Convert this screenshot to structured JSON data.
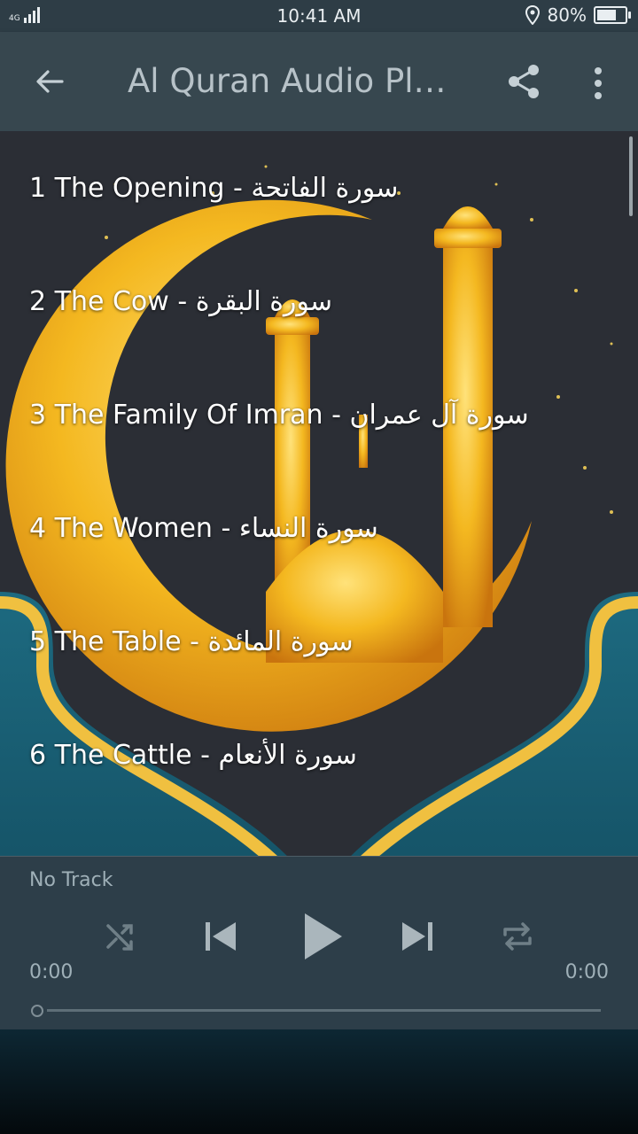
{
  "status_bar": {
    "network": "4G",
    "time": "10:41 AM",
    "battery": "80%",
    "battery_level": 0.8
  },
  "app_bar": {
    "title": "Al Quran Audio Play...",
    "back_icon": "arrow-left-icon",
    "share_icon": "share-icon",
    "menu_icon": "more-vert-icon"
  },
  "surahs": [
    {
      "label": "1 The Opening - ",
      "arabic": "سورة الفاتحة"
    },
    {
      "label": "2 The Cow - ",
      "arabic": "سورة البقرة"
    },
    {
      "label": "3 The Family Of Imran - ",
      "arabic": "سورة آل عمران"
    },
    {
      "label": "4 The Women - ",
      "arabic": "سورة النساء"
    },
    {
      "label": "5 The Table - ",
      "arabic": "سورة المائدة"
    },
    {
      "label": "6 The Cattle - ",
      "arabic": "سورة الأنعام"
    }
  ],
  "player": {
    "track": "No Track",
    "elapsed": "0:00",
    "duration": "0:00",
    "progress": 0,
    "controls": [
      "shuffle-icon",
      "skip-previous-icon",
      "play-icon",
      "skip-next-icon",
      "repeat-icon"
    ]
  },
  "colors": {
    "status_bar": "#2e3d46",
    "app_bar": "#37474f",
    "player_bg": "#30424c",
    "gold": "#f4b820",
    "teal": "#1f6f86"
  }
}
